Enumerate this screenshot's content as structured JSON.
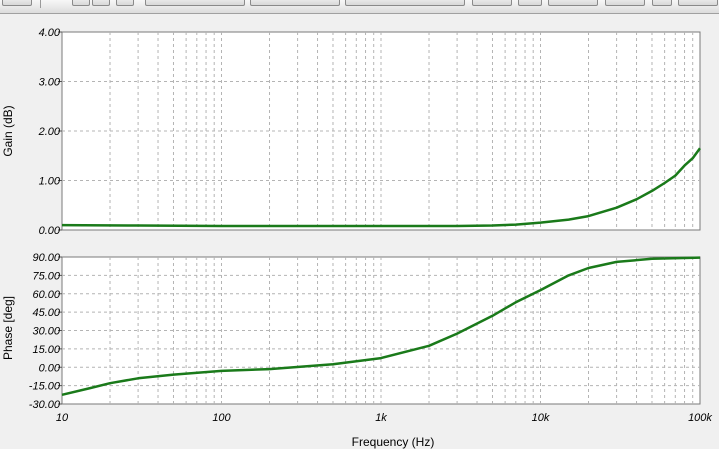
{
  "chart_data": [
    {
      "type": "line",
      "panel": "gain",
      "ylabel": "Gain (dB)",
      "xlabel": "",
      "x_scale": "log",
      "xlim": [
        10,
        100000
      ],
      "ylim": [
        0,
        4
      ],
      "grid": true,
      "yticks": [
        "0.00",
        "1.00",
        "2.00",
        "3.00",
        "4.00"
      ],
      "yticks_values": [
        0,
        1,
        2,
        3,
        4
      ],
      "xticks": [
        "10",
        "100",
        "1k",
        "10k",
        "100k"
      ],
      "xticks_values": [
        10,
        100,
        1000,
        10000,
        100000
      ],
      "line_color": "#1a7a1a",
      "series": [
        {
          "x": [
            10,
            30,
            100,
            300,
            1000,
            3000,
            5000,
            7000,
            10000,
            15000,
            20000,
            30000,
            40000,
            50000,
            60000,
            70000,
            80000,
            90000,
            100000
          ],
          "y": [
            0.1,
            0.09,
            0.08,
            0.08,
            0.08,
            0.08,
            0.09,
            0.11,
            0.15,
            0.21,
            0.28,
            0.45,
            0.62,
            0.79,
            0.95,
            1.1,
            1.3,
            1.45,
            1.65
          ]
        }
      ]
    },
    {
      "type": "line",
      "panel": "phase",
      "ylabel": "Phase [deg]",
      "xlabel": "Frequency (Hz)",
      "x_scale": "log",
      "xlim": [
        10,
        100000
      ],
      "ylim": [
        -30,
        90
      ],
      "grid": true,
      "yticks": [
        "-30.00",
        "-15.00",
        "0.00",
        "15.00",
        "30.00",
        "45.00",
        "60.00",
        "75.00",
        "90.00"
      ],
      "yticks_values": [
        -30,
        -15,
        0,
        15,
        30,
        45,
        60,
        75,
        90
      ],
      "xticks": [
        "10",
        "100",
        "1k",
        "10k",
        "100k"
      ],
      "xticks_values": [
        10,
        100,
        1000,
        10000,
        100000
      ],
      "line_color": "#1a7a1a",
      "series": [
        {
          "x": [
            10,
            15,
            20,
            30,
            50,
            100,
            200,
            500,
            1000,
            2000,
            3000,
            5000,
            7000,
            10000,
            15000,
            20000,
            30000,
            50000,
            100000
          ],
          "y": [
            -22.5,
            -17,
            -13,
            -9,
            -6,
            -3,
            -1.5,
            2.5,
            7.5,
            17.5,
            27.5,
            42,
            53,
            63,
            75,
            81,
            86,
            88.5,
            89.5
          ]
        }
      ]
    }
  ]
}
